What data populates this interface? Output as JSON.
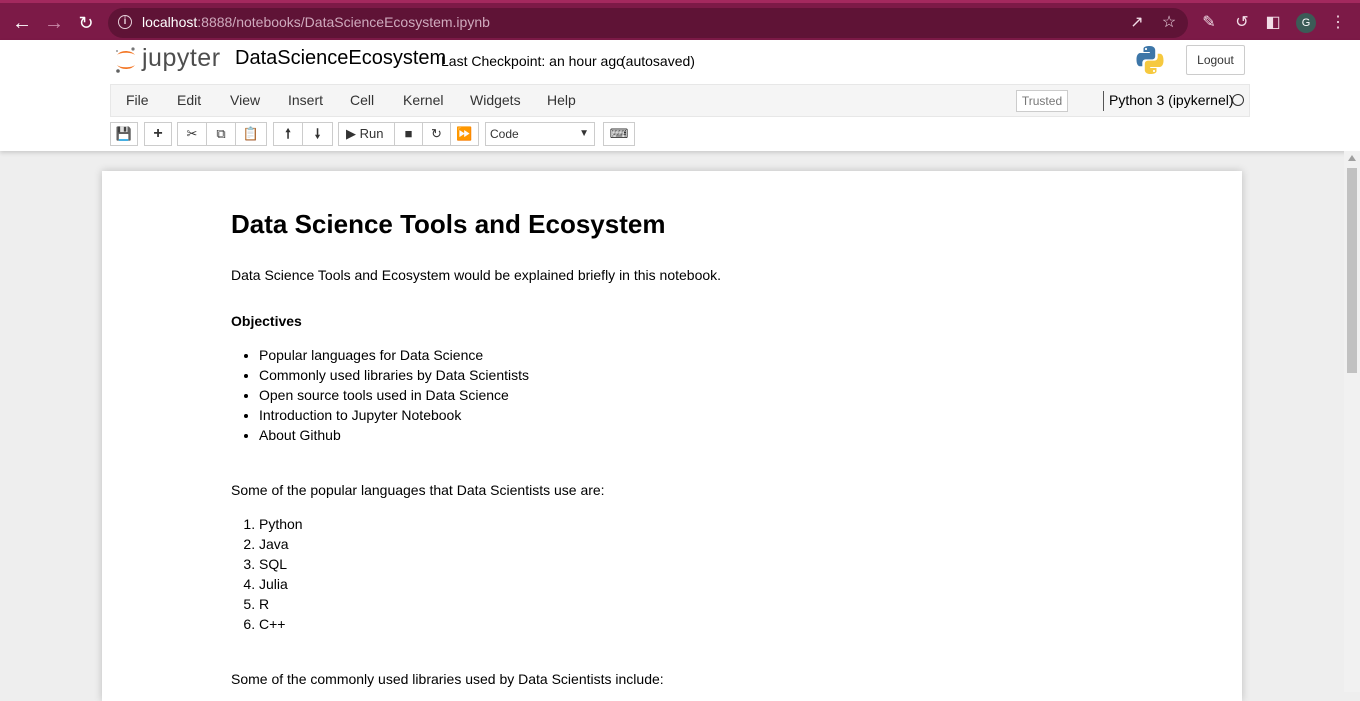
{
  "browser": {
    "url_host": "localhost",
    "url_rest": ":8888/notebooks/DataScienceEcosystem.ipynb",
    "avatar_letter": "G"
  },
  "header": {
    "logo_text": "jupyter",
    "notebook_name": "DataScienceEcosystem",
    "checkpoint": "Last Checkpoint: an hour ago",
    "autosaved": "(autosaved)",
    "logout_label": "Logout"
  },
  "menu": {
    "items": [
      "File",
      "Edit",
      "View",
      "Insert",
      "Cell",
      "Kernel",
      "Widgets",
      "Help"
    ],
    "trusted_label": "Trusted",
    "kernel_name": "Python 3 (ipykernel)"
  },
  "toolbar": {
    "run_label": "Run",
    "cell_type": "Code"
  },
  "notebook": {
    "title": "Data Science Tools and Ecosystem",
    "intro": "Data Science Tools and Ecosystem would be explained briefly in this notebook.",
    "objectives_heading": "Objectives",
    "objectives": [
      "Popular languages for Data Science",
      "Commonly used libraries by Data Scientists",
      "Open source tools used in Data Science",
      "Introduction to Jupyter Notebook",
      "About Github"
    ],
    "languages_intro": "Some of the popular languages that Data Scientists use are:",
    "languages": [
      "Python",
      "Java",
      "SQL",
      "Julia",
      "R",
      "C++"
    ],
    "libraries_intro": "Some of the commonly used libraries used by Data Scientists include:"
  },
  "colors": {
    "browser_frame": "#7c1a47",
    "url_box": "#5f1336"
  }
}
